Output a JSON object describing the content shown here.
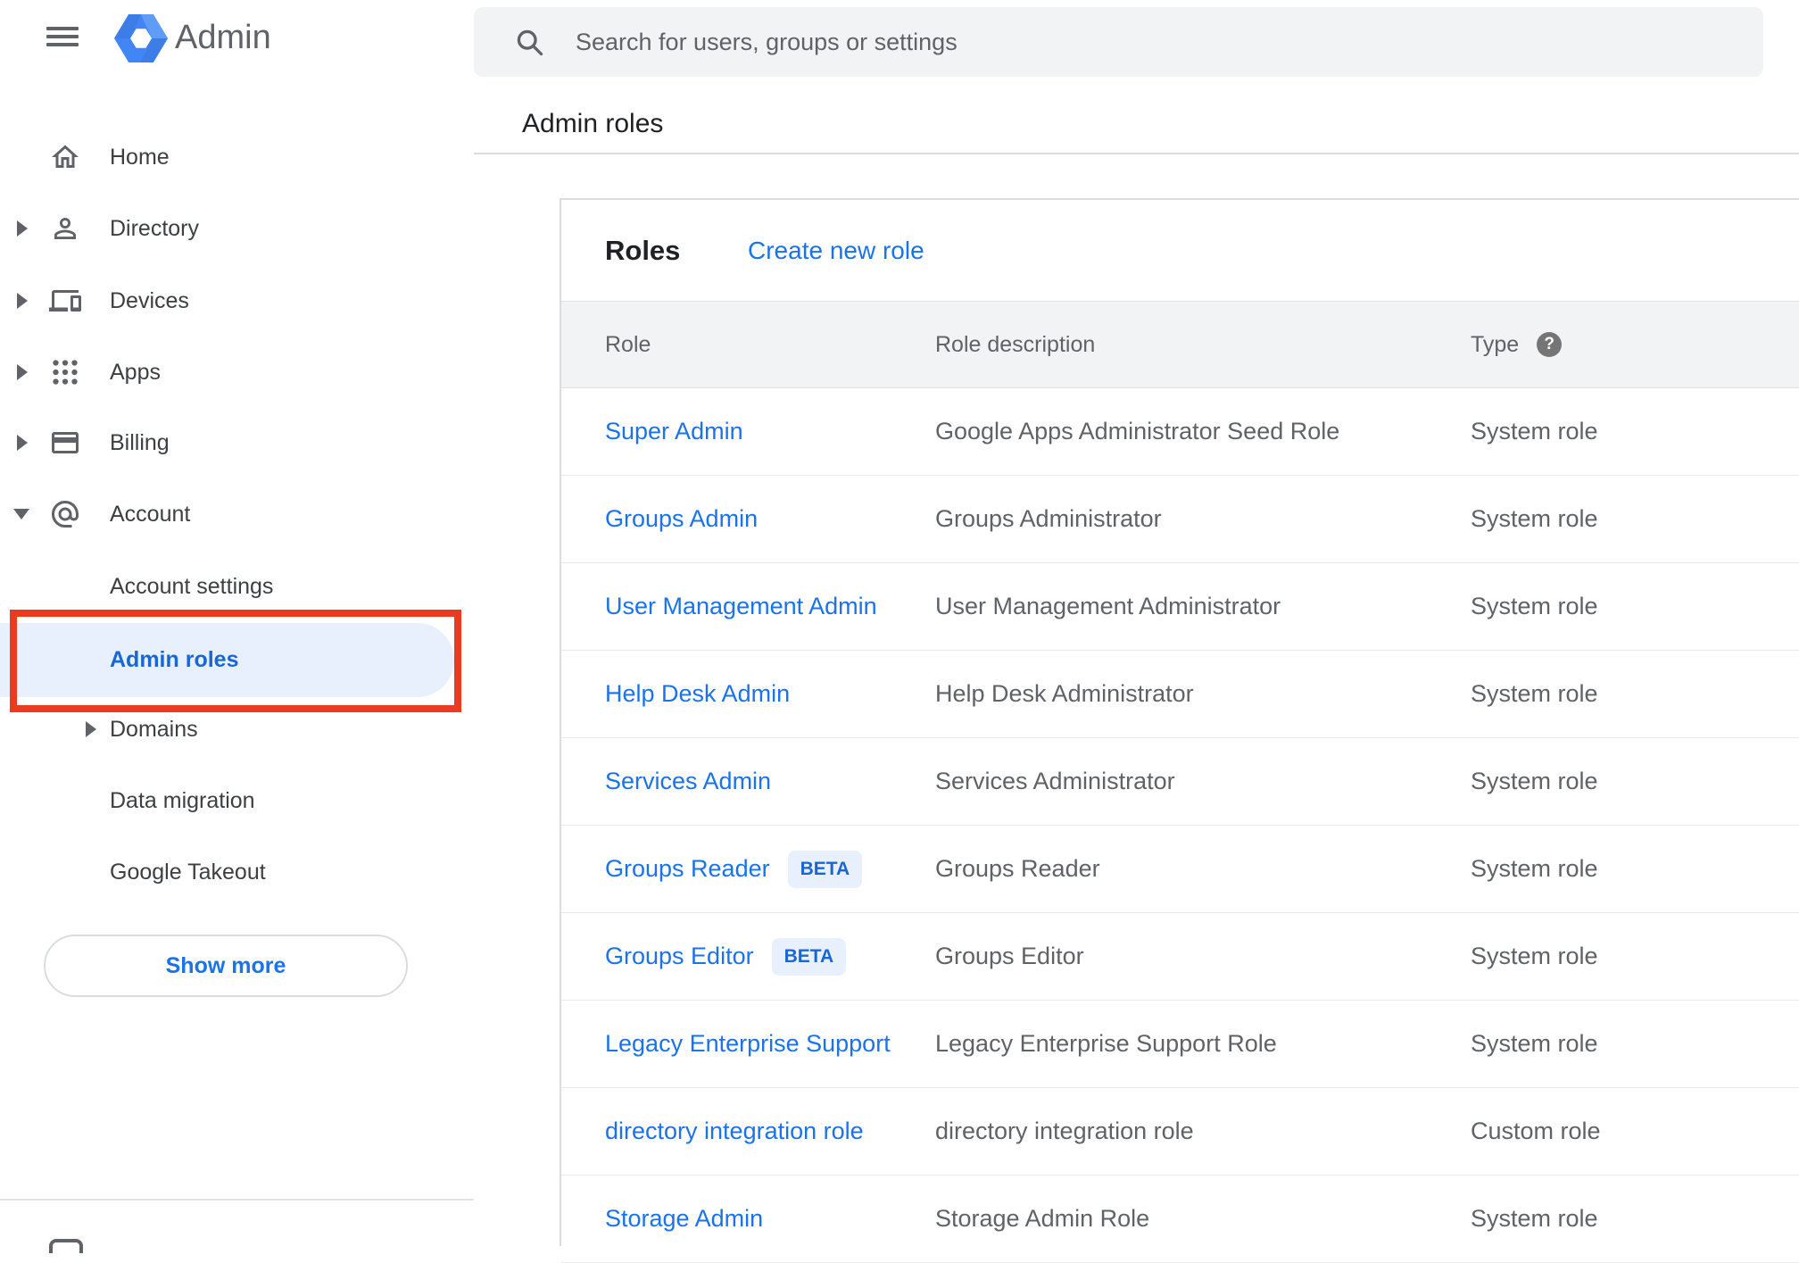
{
  "topbar": {
    "app_title": "Admin",
    "search_placeholder": "Search for users, groups or settings"
  },
  "breadcrumb": "Admin roles",
  "sidebar": {
    "items": [
      {
        "label": "Home",
        "icon": "home-icon",
        "expandable": false
      },
      {
        "label": "Directory",
        "icon": "person-icon",
        "expandable": true
      },
      {
        "label": "Devices",
        "icon": "devices-icon",
        "expandable": true
      },
      {
        "label": "Apps",
        "icon": "apps-icon",
        "expandable": true
      },
      {
        "label": "Billing",
        "icon": "billing-icon",
        "expandable": true
      },
      {
        "label": "Account",
        "icon": "at-icon",
        "expandable": true,
        "expanded": true
      }
    ],
    "account_children": [
      {
        "label": "Account settings",
        "selected": false
      },
      {
        "label": "Admin roles",
        "selected": true,
        "annotated": true
      },
      {
        "label": "Domains",
        "selected": false,
        "expandable": true
      },
      {
        "label": "Data migration",
        "selected": false
      },
      {
        "label": "Google Takeout",
        "selected": false
      }
    ],
    "show_more_label": "Show more"
  },
  "panel": {
    "title": "Roles",
    "create_link": "Create new role",
    "columns": [
      "Role",
      "Role description",
      "Type"
    ],
    "help_icon_glyph": "?",
    "beta_label": "BETA",
    "rows": [
      {
        "role": "Super Admin",
        "beta": false,
        "description": "Google Apps Administrator Seed Role",
        "type": "System role"
      },
      {
        "role": "Groups Admin",
        "beta": false,
        "description": "Groups Administrator",
        "type": "System role"
      },
      {
        "role": "User Management Admin",
        "beta": false,
        "description": "User Management Administrator",
        "type": "System role"
      },
      {
        "role": "Help Desk Admin",
        "beta": false,
        "description": "Help Desk Administrator",
        "type": "System role"
      },
      {
        "role": "Services Admin",
        "beta": false,
        "description": "Services Administrator",
        "type": "System role"
      },
      {
        "role": "Groups Reader",
        "beta": true,
        "description": "Groups Reader",
        "type": "System role"
      },
      {
        "role": "Groups Editor",
        "beta": true,
        "description": "Groups Editor",
        "type": "System role"
      },
      {
        "role": "Legacy Enterprise Support",
        "beta": false,
        "description": "Legacy Enterprise Support Role",
        "type": "System role"
      },
      {
        "role": "directory integration role",
        "beta": false,
        "description": "directory integration role",
        "type": "Custom role"
      },
      {
        "role": "Storage Admin",
        "beta": false,
        "description": "Storage Admin Role",
        "type": "System role"
      }
    ]
  },
  "colors": {
    "accent_blue": "#1a73e8",
    "selected_text": "#1967d2",
    "selected_bg": "#e8f0fe",
    "annotation_red": "#ea3b21",
    "table_header_bg": "#f1f3f4",
    "icon_gray": "#5f6368"
  }
}
